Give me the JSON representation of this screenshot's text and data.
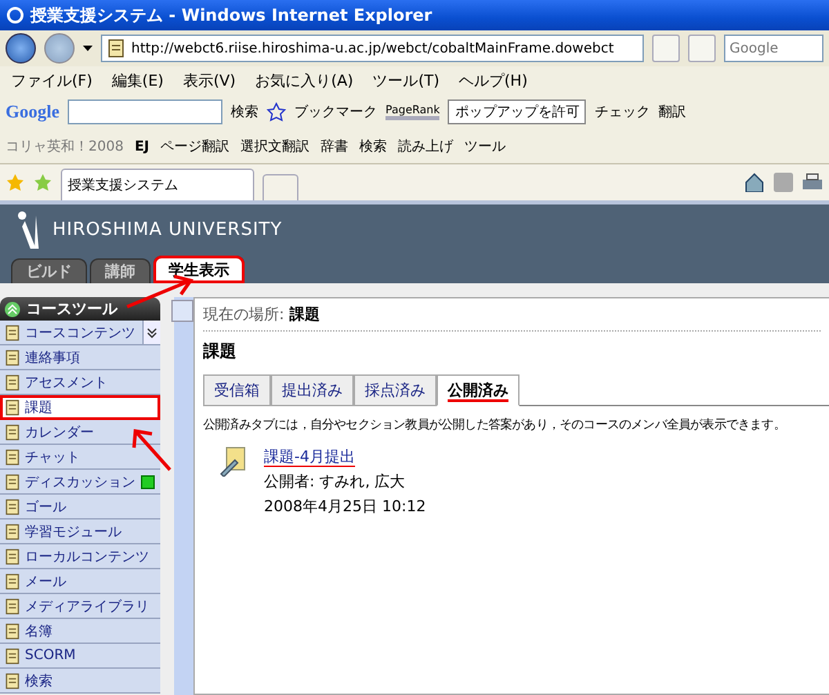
{
  "window": {
    "title": "授業支援システム - Windows Internet Explorer"
  },
  "address_bar": {
    "url": "http://webct6.riise.hiroshima-u.ac.jp/webct/cobaltMainFrame.dowebct",
    "search_placeholder": "Google"
  },
  "menu": [
    "ファイル(F)",
    "編集(E)",
    "表示(V)",
    "お気に入り(A)",
    "ツール(T)",
    "ヘルプ(H)"
  ],
  "google_toolbar": {
    "logo": "Google",
    "search_button": "検索",
    "bookmark": "ブックマーク",
    "pagerank": "PageRank",
    "popup_button": "ポップアップを許可",
    "check": "チェック",
    "translate": "翻訳"
  },
  "korya_toolbar": {
    "label": "コリャ英和！2008",
    "ej": "EJ",
    "buttons": [
      "ページ翻訳",
      "選択文翻訳",
      "辞書",
      "検索",
      "読み上げ",
      "ツール"
    ]
  },
  "browser_tab": {
    "title": "授業支援システム"
  },
  "header": {
    "university": "HIROSHIMA UNIVERSITY",
    "tabs": [
      {
        "label": "ビルド",
        "selected": false,
        "annotated": false
      },
      {
        "label": "講師",
        "selected": false,
        "annotated": false
      },
      {
        "label": "学生表示",
        "selected": true,
        "annotated": true
      }
    ]
  },
  "sidebar": {
    "title": "コースツール",
    "items": [
      {
        "label": "コースコンテンツ",
        "selected": false,
        "annotated": false,
        "badge": false,
        "expander": true
      },
      {
        "label": "連絡事項",
        "selected": false,
        "annotated": false,
        "badge": false,
        "expander": false
      },
      {
        "label": "アセスメント",
        "selected": false,
        "annotated": false,
        "badge": false,
        "expander": false
      },
      {
        "label": "課題",
        "selected": true,
        "annotated": true,
        "badge": false,
        "expander": false
      },
      {
        "label": "カレンダー",
        "selected": false,
        "annotated": false,
        "badge": false,
        "expander": false
      },
      {
        "label": "チャット",
        "selected": false,
        "annotated": false,
        "badge": false,
        "expander": false
      },
      {
        "label": "ディスカッション",
        "selected": false,
        "annotated": false,
        "badge": true,
        "expander": false
      },
      {
        "label": "ゴール",
        "selected": false,
        "annotated": false,
        "badge": false,
        "expander": false
      },
      {
        "label": "学習モジュール",
        "selected": false,
        "annotated": false,
        "badge": false,
        "expander": false
      },
      {
        "label": "ローカルコンテンツ",
        "selected": false,
        "annotated": false,
        "badge": false,
        "expander": false
      },
      {
        "label": "メール",
        "selected": false,
        "annotated": false,
        "badge": false,
        "expander": false
      },
      {
        "label": "メディアライブラリ",
        "selected": false,
        "annotated": false,
        "badge": false,
        "expander": false
      },
      {
        "label": "名簿",
        "selected": false,
        "annotated": false,
        "badge": false,
        "expander": false
      },
      {
        "label": "SCORM",
        "selected": false,
        "annotated": false,
        "badge": false,
        "expander": false
      },
      {
        "label": "検索",
        "selected": false,
        "annotated": false,
        "badge": false,
        "expander": false
      }
    ]
  },
  "content": {
    "breadcrumb_label": "現在の場所:",
    "breadcrumb": "課題",
    "title": "課題",
    "tabs": [
      {
        "label": "受信箱",
        "selected": false,
        "annotated": false
      },
      {
        "label": "提出済み",
        "selected": false,
        "annotated": false
      },
      {
        "label": "採点済み",
        "selected": false,
        "annotated": false
      },
      {
        "label": "公開済み",
        "selected": true,
        "annotated": true
      }
    ],
    "description": "公開済みタブには，自分やセクション教員が公開した答案があり，そのコースのメンバ全員が表示できます。",
    "entries": [
      {
        "title": "課題-4月提出",
        "annotated": true,
        "publisher": "公開者: すみれ, 広大",
        "date": "2008年4月25日 10:12"
      }
    ]
  }
}
